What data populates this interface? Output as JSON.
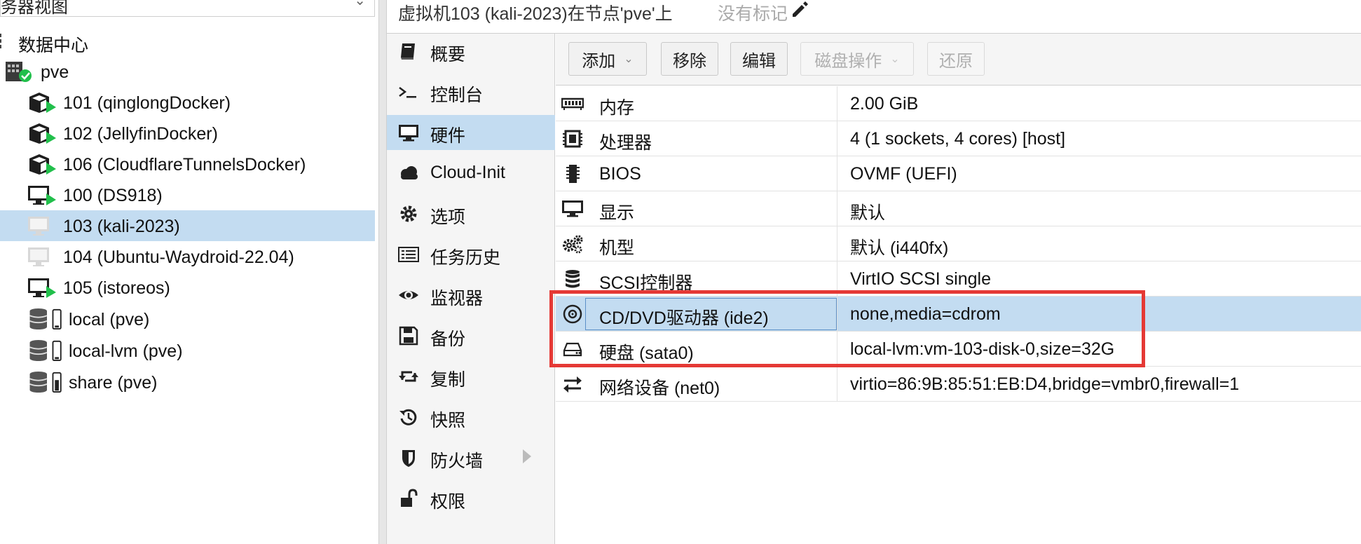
{
  "tree": {
    "header_label": "务器视图",
    "items": [
      {
        "label": "数据中心",
        "icon": "datacenter-icon"
      },
      {
        "label": "pve",
        "icon": "node-online-icon"
      },
      {
        "label": "101 (qinglongDocker)",
        "icon": "container-running-icon"
      },
      {
        "label": "102 (JellyfinDocker)",
        "icon": "container-running-icon"
      },
      {
        "label": "106 (CloudflareTunnelsDocker)",
        "icon": "container-running-icon"
      },
      {
        "label": "100 (DS918)",
        "icon": "vm-running-icon"
      },
      {
        "label": "103 (kali-2023)",
        "icon": "vm-stopped-icon"
      },
      {
        "label": "104 (Ubuntu-Waydroid-22.04)",
        "icon": "vm-stopped-icon"
      },
      {
        "label": "105 (istoreos)",
        "icon": "vm-running-icon"
      },
      {
        "label": "local (pve)",
        "icon": "storage-icon"
      },
      {
        "label": "local-lvm (pve)",
        "icon": "storage-icon"
      },
      {
        "label": "share (pve)",
        "icon": "storage-icon"
      }
    ]
  },
  "title": {
    "vm_title": "虚拟机103 (kali-2023)在节点'pve'上",
    "tags_label": "没有标记"
  },
  "nav": {
    "items": [
      {
        "label": "概要",
        "icon": "book-icon"
      },
      {
        "label": "控制台",
        "icon": "terminal-icon"
      },
      {
        "label": "硬件",
        "icon": "desktop-icon"
      },
      {
        "label": "Cloud-Init",
        "icon": "cloud-icon"
      },
      {
        "label": "选项",
        "icon": "gear-icon"
      },
      {
        "label": "任务历史",
        "icon": "list-icon"
      },
      {
        "label": "监视器",
        "icon": "eye-icon"
      },
      {
        "label": "备份",
        "icon": "floppy-icon"
      },
      {
        "label": "复制",
        "icon": "retweet-icon"
      },
      {
        "label": "快照",
        "icon": "history-icon"
      },
      {
        "label": "防火墙",
        "icon": "shield-icon"
      },
      {
        "label": "权限",
        "icon": "unlock-icon"
      }
    ]
  },
  "toolbar": {
    "add": "添加",
    "remove": "移除",
    "edit": "编辑",
    "disk_action": "磁盘操作",
    "revert": "还原"
  },
  "hardware": {
    "rows": [
      {
        "name": "内存",
        "value": "2.00 GiB",
        "icon": "memory-icon"
      },
      {
        "name": "处理器",
        "value": "4 (1 sockets, 4 cores) [host]",
        "icon": "cpu-icon"
      },
      {
        "name": "BIOS",
        "value": "OVMF (UEFI)",
        "icon": "microchip-icon"
      },
      {
        "name": "显示",
        "value": "默认",
        "icon": "monitor-icon"
      },
      {
        "name": "机型",
        "value": "默认 (i440fx)",
        "icon": "cogs-icon"
      },
      {
        "name": "SCSI控制器",
        "value": "VirtIO SCSI single",
        "icon": "database-icon"
      },
      {
        "name": "CD/DVD驱动器 (ide2)",
        "value": "none,media=cdrom",
        "icon": "cdrom-icon"
      },
      {
        "name": "硬盘 (sata0)",
        "value": "local-lvm:vm-103-disk-0,size=32G",
        "icon": "hdd-icon"
      },
      {
        "name": "网络设备 (net0)",
        "value": "virtio=86:9B:85:51:EB:D4,bridge=vmbr0,firewall=1",
        "icon": "exchange-icon"
      }
    ]
  },
  "colors": {
    "selection": "#c3dcf1",
    "running": "#21bf4b",
    "online": "#21bf4b",
    "highlight": "#e53935"
  }
}
